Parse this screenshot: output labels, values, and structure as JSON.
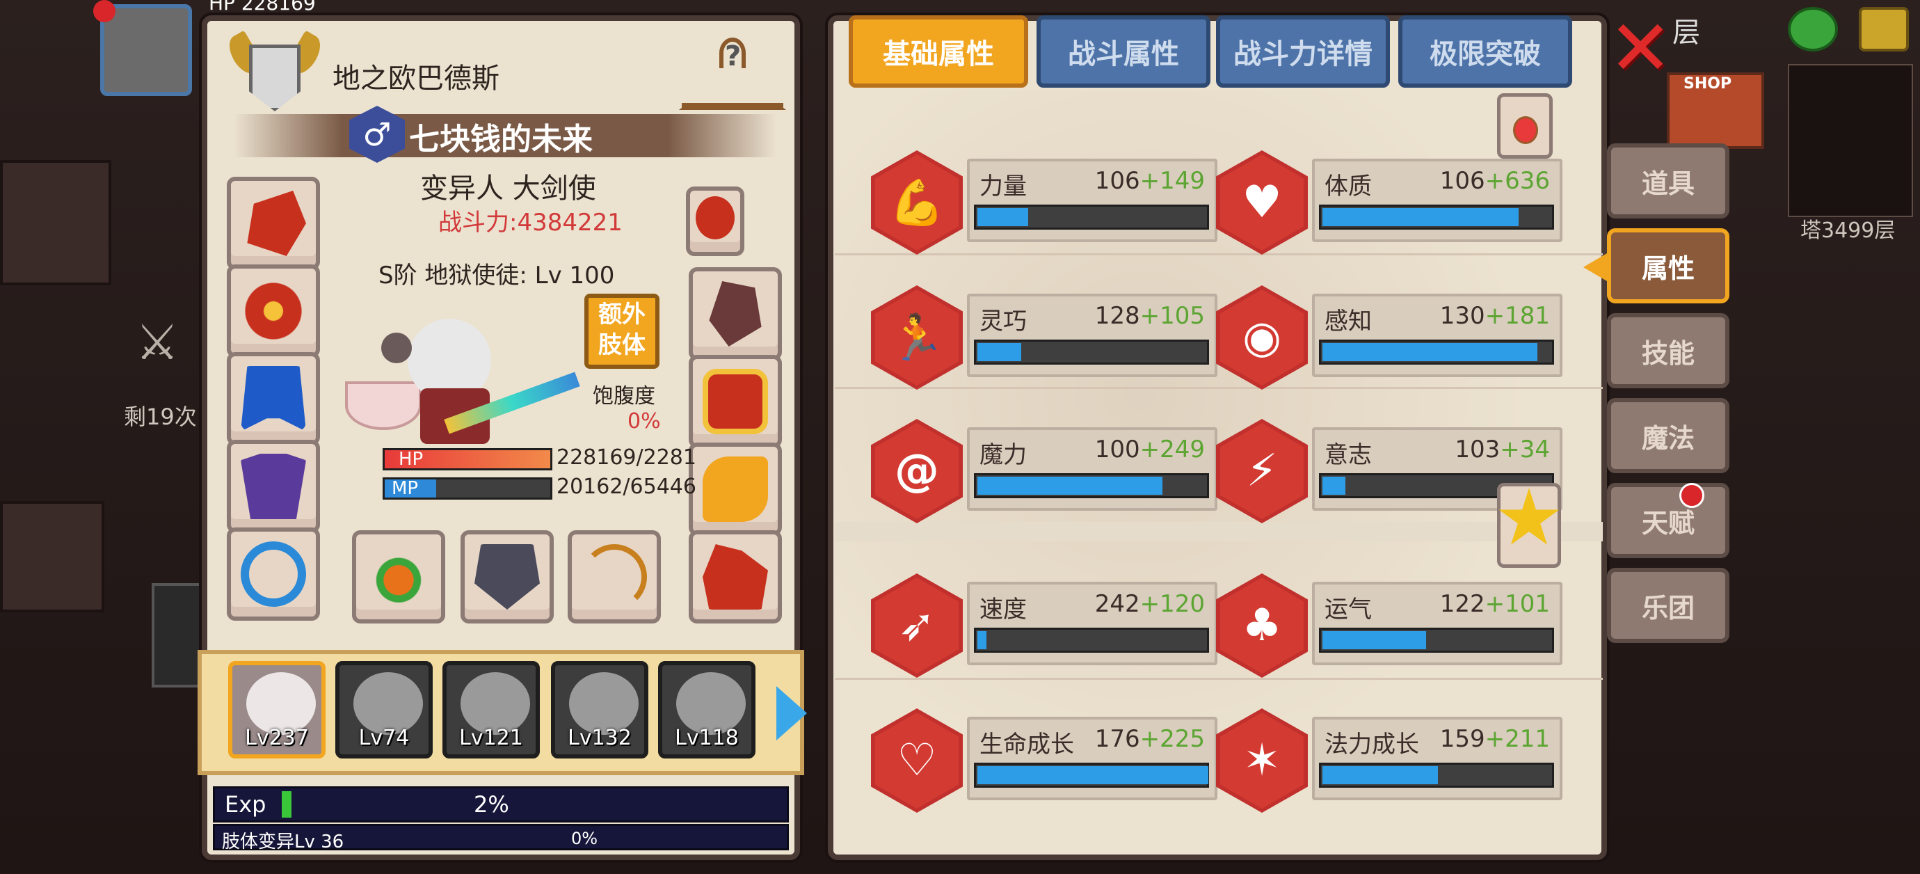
{
  "topbar": {
    "player_hp_partial": "HP 228169",
    "top_right_label_partial": "层"
  },
  "background": {
    "battle_count": "剩19次",
    "tower_label": "塔3499层",
    "shop_sign": "SHOP"
  },
  "character": {
    "name": "地之欧巴德斯",
    "title": "七块钱的未来",
    "class": "变异人 大剑使",
    "combat_power": "战斗力:4384221",
    "rank_line": "S阶 地狱使徒: Lv 100",
    "extra_limb_label": "额外\n肢体",
    "satiety_label": "饱腹度",
    "satiety_value": "0%",
    "hp_label": "HP",
    "hp_value": "228169/2281",
    "hp_fraction": 1.0,
    "mp_label": "MP",
    "mp_value": "20162/65446",
    "mp_fraction": 0.31
  },
  "roster": [
    {
      "level": "Lv237"
    },
    {
      "level": "Lv74"
    },
    {
      "level": "Lv121"
    },
    {
      "level": "Lv132"
    },
    {
      "level": "Lv118"
    }
  ],
  "exp": {
    "label": "Exp",
    "value": "2%",
    "fraction": 0.02,
    "limb_label": "肢体变异Lv 36",
    "limb_value": "0%"
  },
  "tabs": [
    {
      "label": "基础属性",
      "active": true
    },
    {
      "label": "战斗属性",
      "active": false
    },
    {
      "label": "战斗力详情",
      "active": false
    },
    {
      "label": "极限突破",
      "active": false
    }
  ],
  "stats": [
    {
      "name": "力量",
      "base": "106",
      "bonus": "+149",
      "fill": 0.22,
      "icon": "muscle-icon"
    },
    {
      "name": "体质",
      "base": "106",
      "bonus": "+636",
      "fill": 0.85,
      "icon": "body-icon"
    },
    {
      "name": "灵巧",
      "base": "128",
      "bonus": "+105",
      "fill": 0.19,
      "icon": "runner-icon"
    },
    {
      "name": "感知",
      "base": "130",
      "bonus": "+181",
      "fill": 0.93,
      "icon": "eye-icon"
    },
    {
      "name": "魔力",
      "base": "100",
      "bonus": "+249",
      "fill": 0.8,
      "icon": "swirl-icon"
    },
    {
      "name": "意志",
      "base": "103",
      "bonus": "+34",
      "fill": 0.1,
      "icon": "mind-icon"
    },
    {
      "name": "速度",
      "base": "242",
      "bonus": "+120",
      "fill": 0.04,
      "icon": "wing-icon"
    },
    {
      "name": "运气",
      "base": "122",
      "bonus": "+101",
      "fill": 0.45,
      "icon": "clover-icon"
    },
    {
      "name": "生命成长",
      "base": "176",
      "bonus": "+225",
      "fill": 1.0,
      "icon": "heart-icon"
    },
    {
      "name": "法力成长",
      "base": "159",
      "bonus": "+211",
      "fill": 0.5,
      "icon": "star-figure-icon"
    }
  ],
  "side_menu": [
    {
      "label": "道具",
      "active": false
    },
    {
      "label": "属性",
      "active": true
    },
    {
      "label": "技能",
      "active": false
    },
    {
      "label": "魔法",
      "active": false
    },
    {
      "label": "天赋",
      "active": false,
      "badge": true
    },
    {
      "label": "乐团",
      "active": false
    }
  ],
  "colors": {
    "accent_orange": "#f2a51f",
    "tab_blue": "#4d73a8",
    "stat_red": "#c8352e",
    "bar_blue": "#2e9de7",
    "bonus_green": "#5ca532"
  }
}
